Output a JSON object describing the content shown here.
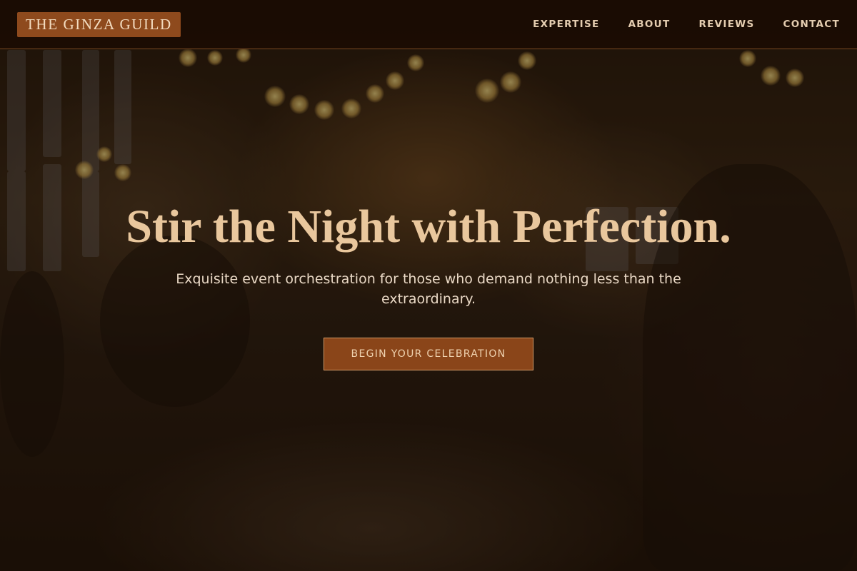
{
  "brand": {
    "name": "THE GINZA GUILD"
  },
  "nav": {
    "items": [
      {
        "label": "EXPERTISE"
      },
      {
        "label": "ABOUT"
      },
      {
        "label": "REVIEWS"
      },
      {
        "label": "CONTACT"
      }
    ]
  },
  "hero": {
    "title": "Stir the Night with Perfection.",
    "subtitle": "Exquisite event orchestration for those who demand nothing less than the extraordinary.",
    "cta_label": "BEGIN YOUR CELEBRATION"
  },
  "colors": {
    "nav_background": "#1b0c03",
    "brand_badge": "#8e4a1d",
    "accent_gold": "#e9c79d",
    "cta_background": "#8a4519"
  }
}
